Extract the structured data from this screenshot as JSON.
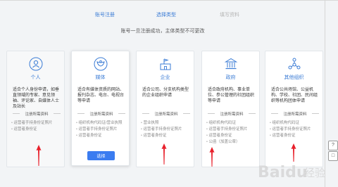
{
  "steps": [
    "账号注册",
    "选择类型",
    "填写资料"
  ],
  "notice": "账号一旦注册成功，主体类型不可更改",
  "cards": [
    {
      "title": "个人",
      "desc": "适合个人身份申请，如垂直领域的专家、意见领袖、评论家、自媒体人士及站长",
      "section": "注册所需资料",
      "reqs": [
        "运营者手持身份证照片",
        "运营者身份证"
      ]
    },
    {
      "title": "媒体",
      "desc": "适合有媒体资质的网站、报刊杂志、电台、电视台等申请",
      "section": "注册所需资料",
      "reqs": [
        "组织机构代码证/营业执照",
        "运营者手持身份证照片",
        "运营者身份证"
      ],
      "button": "选择"
    },
    {
      "title": "企业",
      "desc": "适合公司、分支机构类型的企业组织申请",
      "section": "注册所需资料",
      "reqs": [
        "营业执照",
        "运营者手持身份证照片",
        "运营者身份证"
      ]
    },
    {
      "title": "政府",
      "desc": "适合政府机构、事业单位、参公管理的社团组织等申请",
      "section": "注册所需资料",
      "reqs": [
        "组织机构代码证",
        "运营者手持身份证照片",
        "运营者身份证",
        "公函（加盖公章）"
      ]
    },
    {
      "title": "其他组织",
      "desc": "适合公共场馆、公益机构、学校、社团、民间组织等机构团体申请",
      "section": "注册所需资料",
      "reqs": [
        "组织机构代码证",
        "运营者手持身份证照片",
        "运营者身份证"
      ]
    }
  ],
  "side_tools": [
    "?",
    "□"
  ],
  "colors": {
    "accent": "#3a7bd5",
    "button": "#3b7cf0",
    "arrow": "#e8202b"
  },
  "watermark": "Baidu 经验"
}
